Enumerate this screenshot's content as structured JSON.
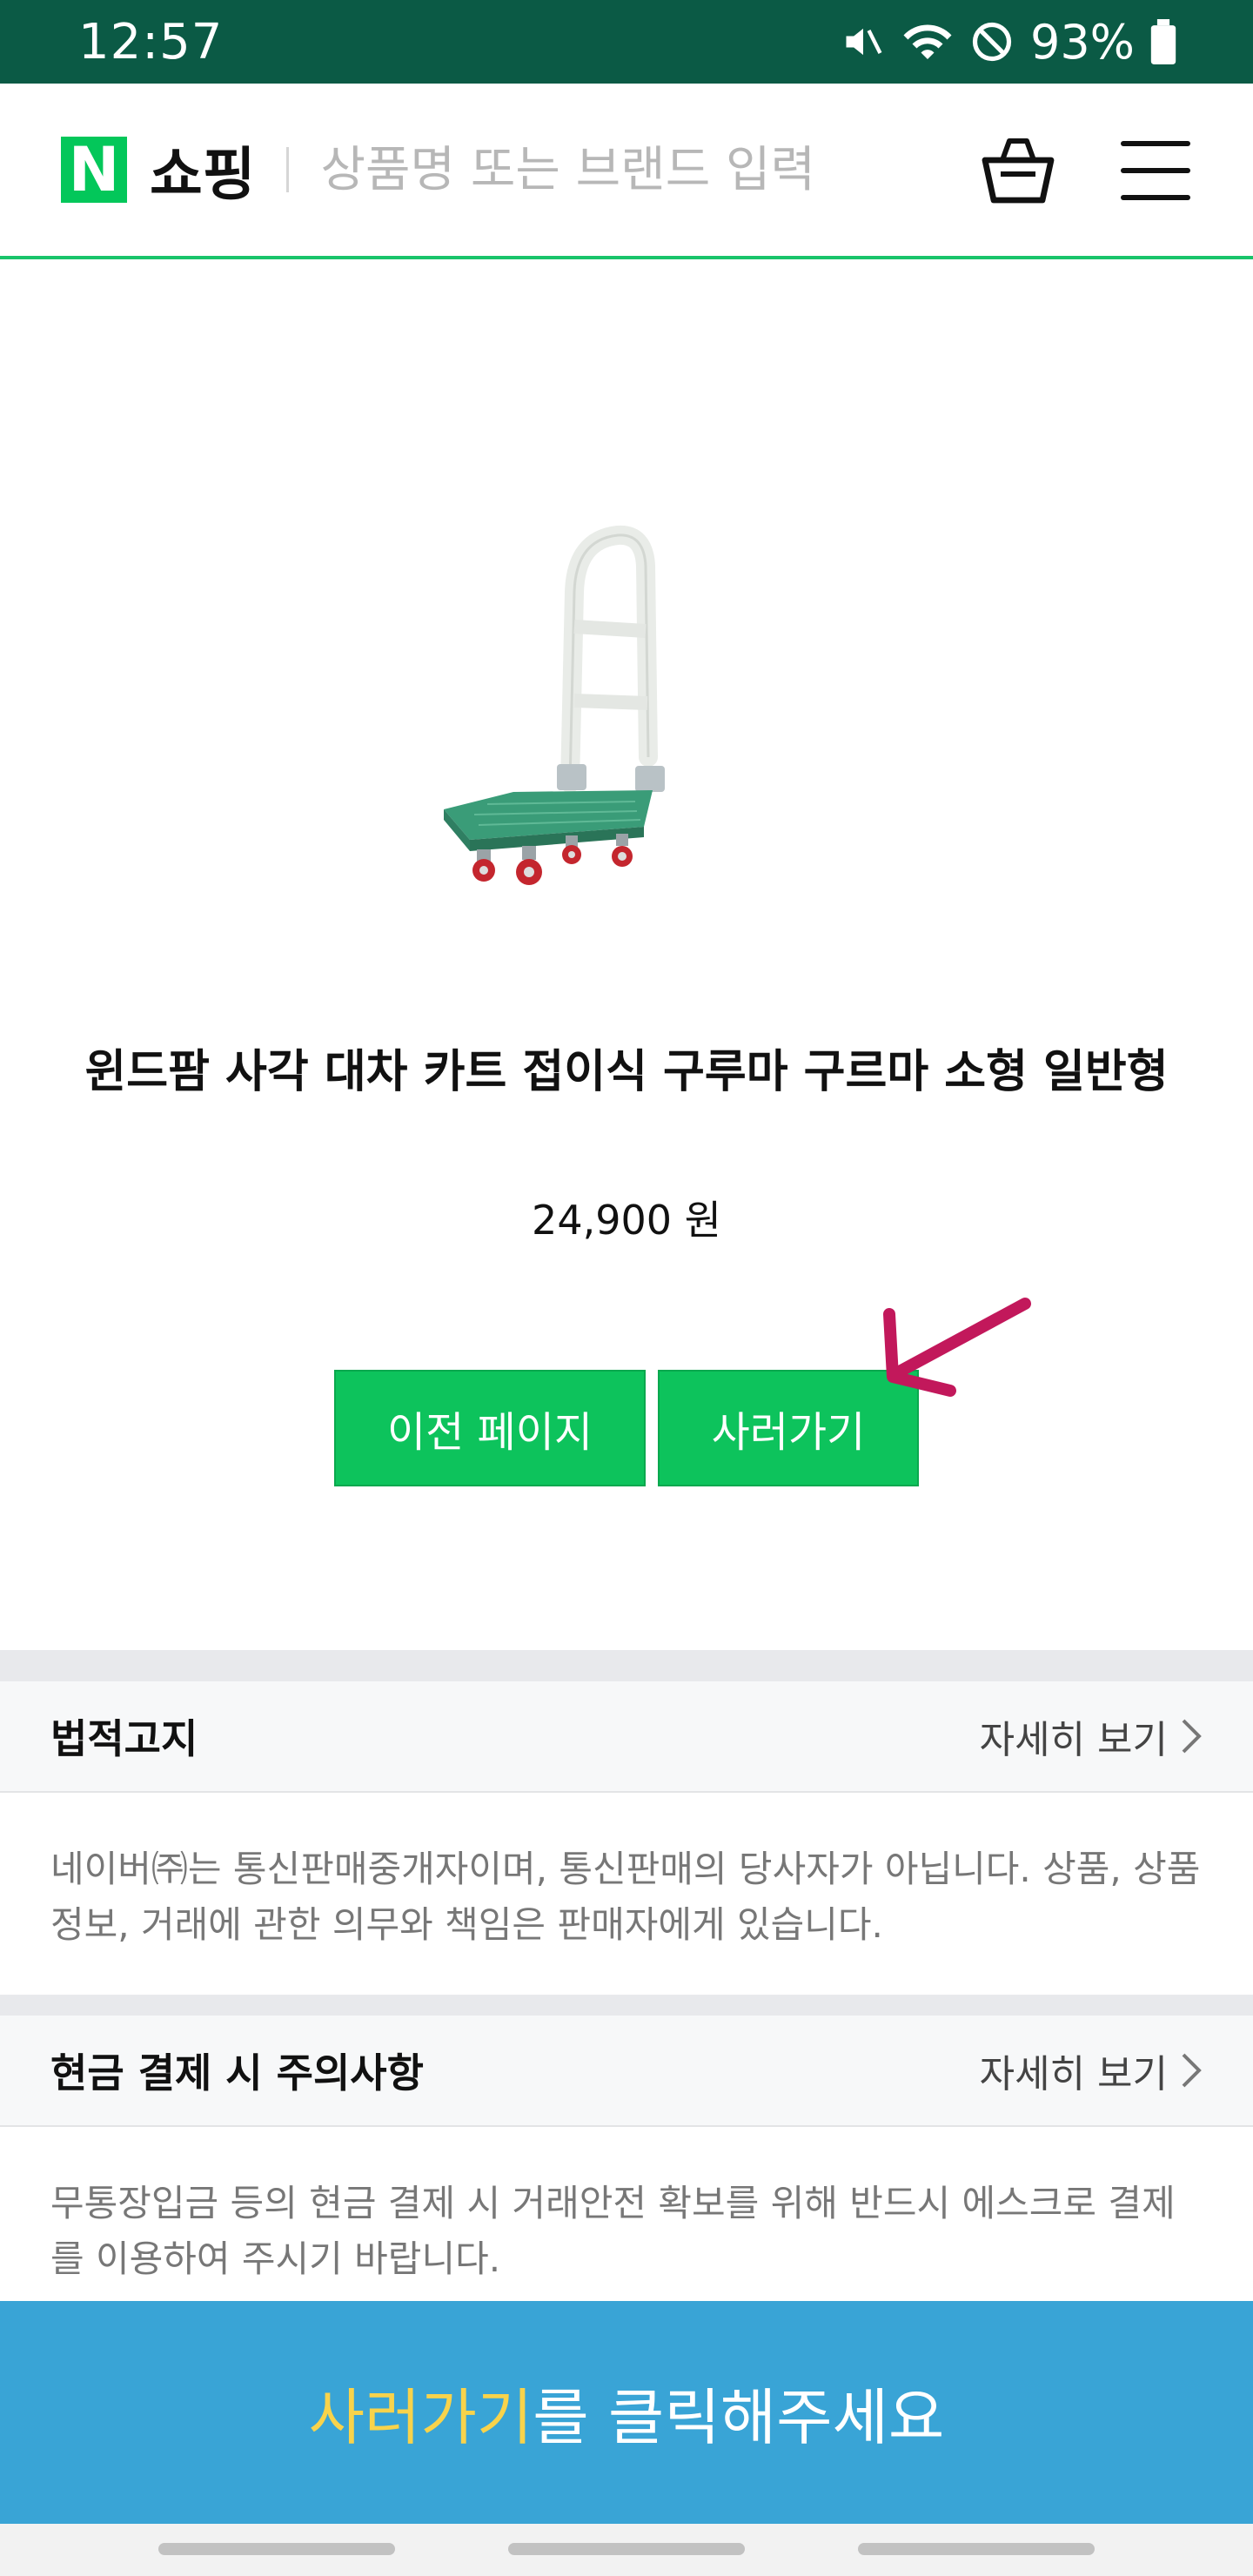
{
  "status_bar": {
    "time": "12:57",
    "battery": "93%"
  },
  "header": {
    "logo_letter": "N",
    "logo_text": "쇼핑",
    "search_placeholder": "상품명 또는 브랜드 입력"
  },
  "product": {
    "title": "윈드팜 사각 대차 카트 접이식 구루마 구르마 소형 일반형",
    "price": "24,900 원"
  },
  "buttons": {
    "prev": "이전 페이지",
    "buy": "사러가기"
  },
  "notices": [
    {
      "title": "법적고지",
      "more": "자세히 보기",
      "body": "네이버㈜는 통신판매중개자이며, 통신판매의 당사자가 아닙니다. 상품, 상품정보, 거래에 관한 의무와 책임은 판매자에게 있습니다."
    },
    {
      "title": "현금 결제 시 주의사항",
      "more": "자세히 보기",
      "body": "무통장입금 등의 현금 결제 시 거래안전 확보를 위해 반드시 에스크로 결제를 이용하여 주시기 바랍니다."
    }
  ],
  "banner": {
    "highlight": "사러가기",
    "rest": "를 클릭해주세요"
  },
  "colors": {
    "brand_green": "#03c75a",
    "status_bar": "#0b5a45",
    "banner_blue": "#39a4d6",
    "banner_highlight": "#f8d34b",
    "arrow": "#c2185b"
  }
}
